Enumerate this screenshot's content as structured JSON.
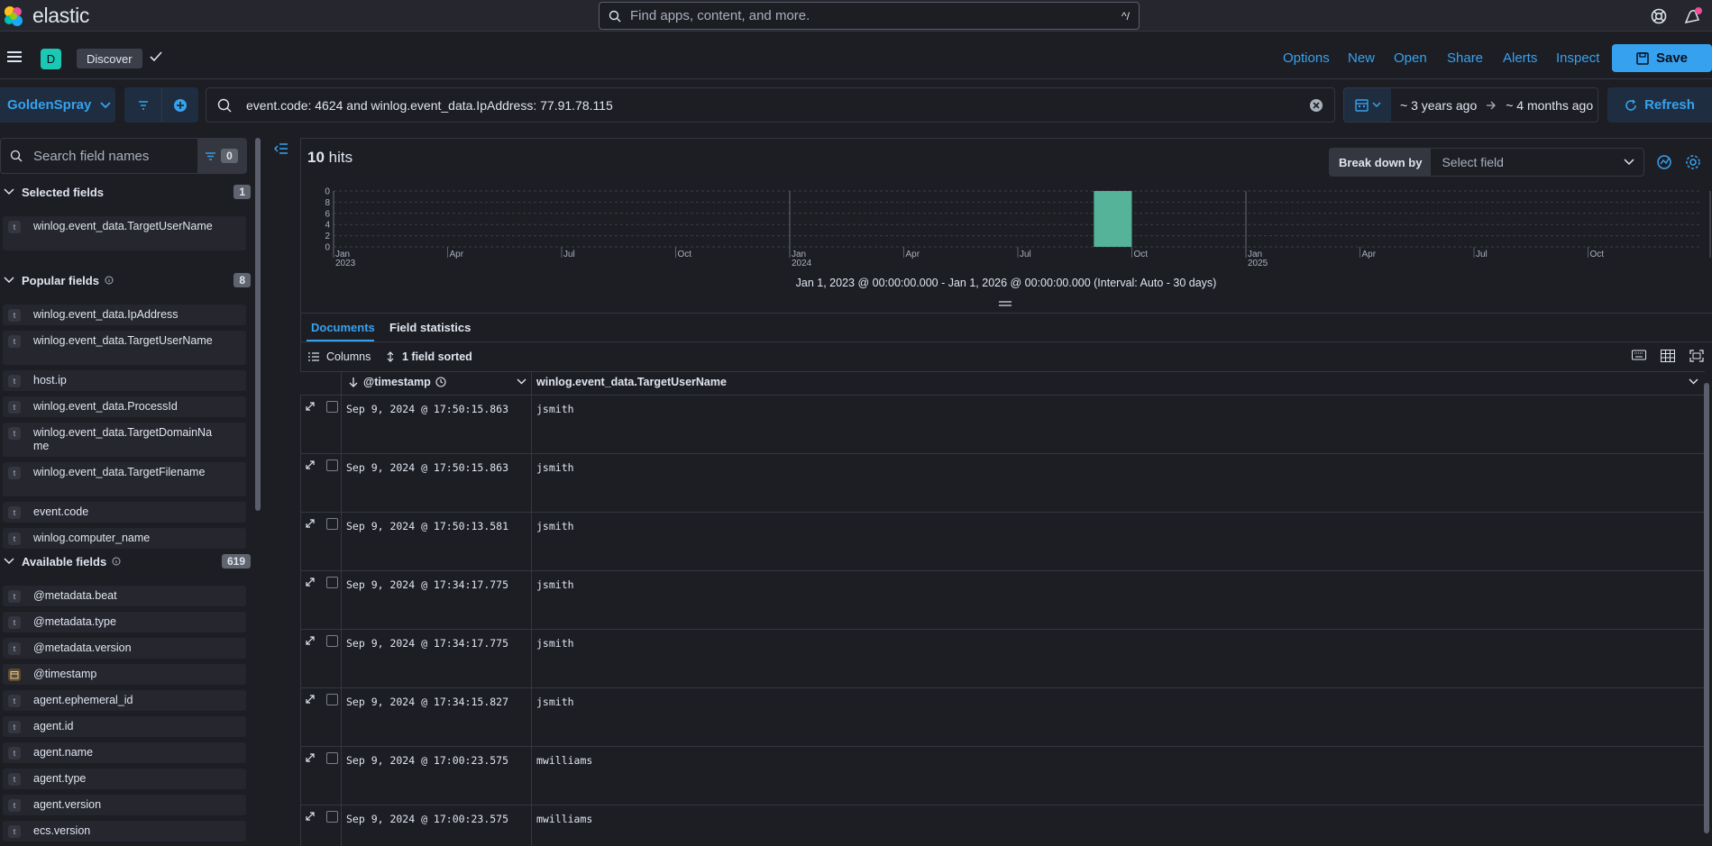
{
  "app": {
    "logo_text": "elastic",
    "global_search_placeholder": "Find apps, content, and more.",
    "global_search_shortcut": "^/"
  },
  "appbar": {
    "space_letter": "D",
    "breadcrumb": "Discover",
    "menu": [
      "Options",
      "New",
      "Open",
      "Share",
      "Alerts",
      "Inspect"
    ],
    "save_label": "Save"
  },
  "querybar": {
    "data_view": "GoldenSpray",
    "query": "event.code: 4624 and winlog.event_data.IpAddress: 77.91.78.115",
    "date_start": "~ 3 years ago",
    "date_end": "~ 4 months ago",
    "refresh_label": "Refresh"
  },
  "sidebar": {
    "search_placeholder": "Search field names",
    "filter_count": "0",
    "selected": {
      "title": "Selected fields",
      "count": "1",
      "fields": [
        {
          "name": "winlog.event_data.TargetUserName",
          "type": "t"
        }
      ]
    },
    "popular": {
      "title": "Popular fields",
      "count": "8",
      "fields": [
        {
          "name": "winlog.event_data.IpAddress",
          "type": "t"
        },
        {
          "name": "winlog.event_data.TargetUserName",
          "type": "t"
        },
        {
          "name": "host.ip",
          "type": "t"
        },
        {
          "name": "winlog.event_data.ProcessId",
          "type": "t"
        },
        {
          "name": "winlog.event_data.TargetDomainName",
          "type": "t"
        },
        {
          "name": "winlog.event_data.TargetFilename",
          "type": "t"
        },
        {
          "name": "event.code",
          "type": "t"
        },
        {
          "name": "winlog.computer_name",
          "type": "t"
        }
      ]
    },
    "available": {
      "title": "Available fields",
      "count": "619",
      "fields": [
        {
          "name": "@metadata.beat",
          "type": "t"
        },
        {
          "name": "@metadata.type",
          "type": "t"
        },
        {
          "name": "@metadata.version",
          "type": "t"
        },
        {
          "name": "@timestamp",
          "type": "date"
        },
        {
          "name": "agent.ephemeral_id",
          "type": "t"
        },
        {
          "name": "agent.id",
          "type": "t"
        },
        {
          "name": "agent.name",
          "type": "t"
        },
        {
          "name": "agent.type",
          "type": "t"
        },
        {
          "name": "agent.version",
          "type": "t"
        },
        {
          "name": "ecs.version",
          "type": "t"
        }
      ]
    }
  },
  "main": {
    "hits_count": "10",
    "hits_label": "hits",
    "breakdown_label": "Break down by",
    "breakdown_placeholder": "Select field",
    "chart_range": "Jan 1, 2023 @ 00:00:00.000 - Jan 1, 2026 @ 00:00:00.000 (Interval: Auto - 30 days)",
    "tabs": [
      "Documents",
      "Field statistics"
    ],
    "columns_label": "Columns",
    "sort_label": "1 field sorted",
    "col_timestamp": "@timestamp",
    "col_user": "winlog.event_data.TargetUserName",
    "rows": [
      {
        "ts": "Sep 9, 2024 @ 17:50:15.863",
        "user": "jsmith"
      },
      {
        "ts": "Sep 9, 2024 @ 17:50:15.863",
        "user": "jsmith"
      },
      {
        "ts": "Sep 9, 2024 @ 17:50:13.581",
        "user": "jsmith"
      },
      {
        "ts": "Sep 9, 2024 @ 17:34:17.775",
        "user": "jsmith"
      },
      {
        "ts": "Sep 9, 2024 @ 17:34:17.775",
        "user": "jsmith"
      },
      {
        "ts": "Sep 9, 2024 @ 17:34:15.827",
        "user": "jsmith"
      },
      {
        "ts": "Sep 9, 2024 @ 17:00:23.575",
        "user": "mwilliams"
      },
      {
        "ts": "Sep 9, 2024 @ 17:00:23.575",
        "user": "mwilliams"
      }
    ]
  },
  "chart_data": {
    "type": "bar",
    "ylim": [
      0,
      10
    ],
    "yticks": [
      "10",
      "8",
      "6",
      "4",
      "2",
      "0"
    ],
    "xticks": [
      {
        "label": "Jan",
        "sub": "2023"
      },
      {
        "label": "Apr",
        "sub": ""
      },
      {
        "label": "Jul",
        "sub": ""
      },
      {
        "label": "Oct",
        "sub": ""
      },
      {
        "label": "Jan",
        "sub": "2024"
      },
      {
        "label": "Apr",
        "sub": ""
      },
      {
        "label": "Jul",
        "sub": ""
      },
      {
        "label": "Oct",
        "sub": ""
      },
      {
        "label": "Jan",
        "sub": "2025"
      },
      {
        "label": "Apr",
        "sub": ""
      },
      {
        "label": "Jul",
        "sub": ""
      },
      {
        "label": "Oct",
        "sub": ""
      }
    ],
    "bars": [
      {
        "bucket": "Sep 2024",
        "value": 10
      }
    ],
    "bar_color": "#54b399",
    "grid": true
  },
  "colors": {
    "accent": "#36a2ef",
    "background": "#1d1e24",
    "bar": "#54b399"
  }
}
